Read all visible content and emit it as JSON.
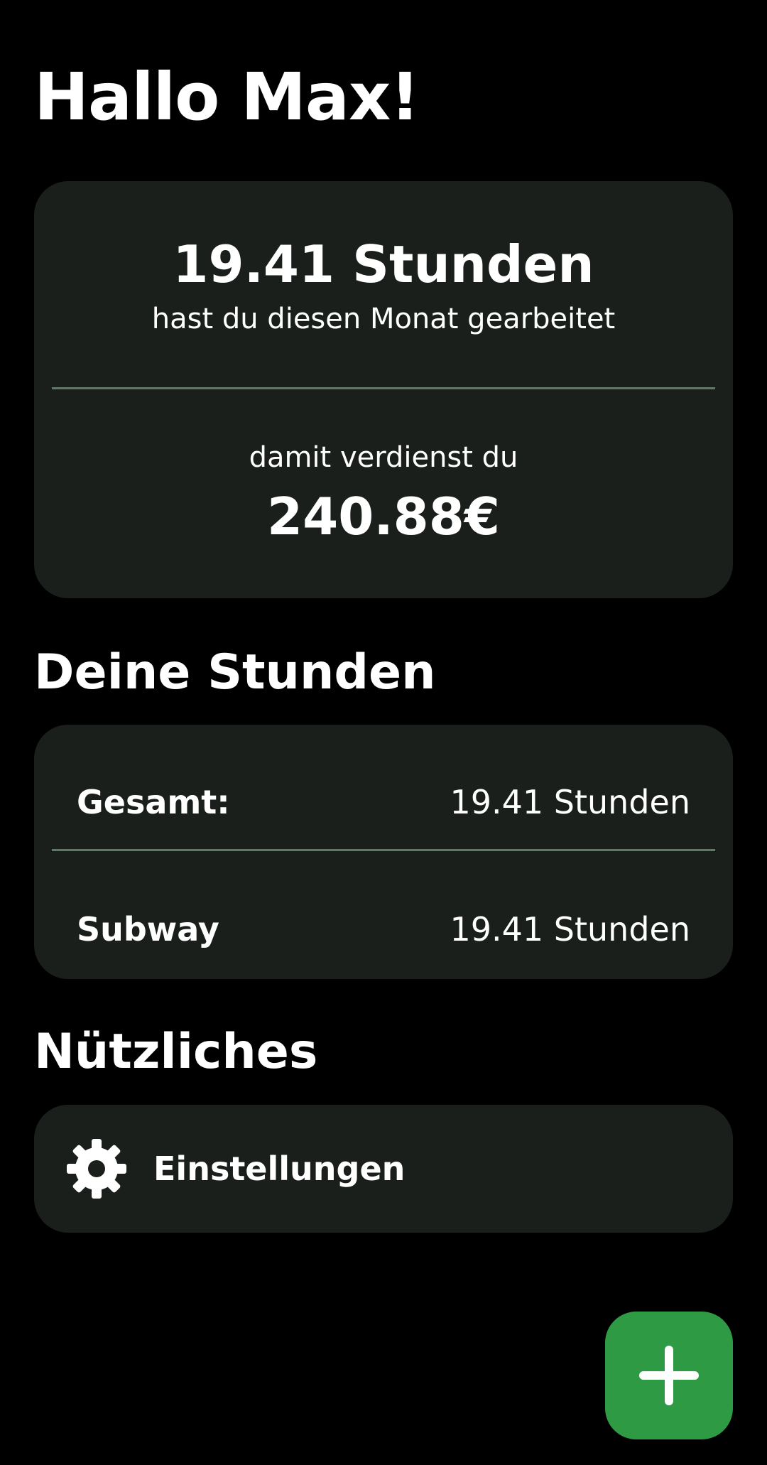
{
  "header": {
    "greeting": "Hallo Max!"
  },
  "summary": {
    "hours": "19.41 Stunden",
    "hours_caption": "hast du diesen Monat gearbeitet",
    "earnings_caption": "damit verdienst du",
    "earnings": "240.88€"
  },
  "hours_section": {
    "title": "Deine Stunden",
    "rows": [
      {
        "label": "Gesamt:",
        "value": "19.41 Stunden"
      },
      {
        "label": "Subway",
        "value": "19.41 Stunden"
      }
    ]
  },
  "useful_section": {
    "title": "Nützliches",
    "items": [
      {
        "label": "Einstellungen",
        "icon": "gear-icon"
      }
    ]
  },
  "fab": {
    "icon": "plus-icon"
  },
  "colors": {
    "background": "#000000",
    "card": "#1a1f1b",
    "divider": "#5d7a63",
    "accent": "#2f9a44",
    "text": "#ffffff"
  }
}
